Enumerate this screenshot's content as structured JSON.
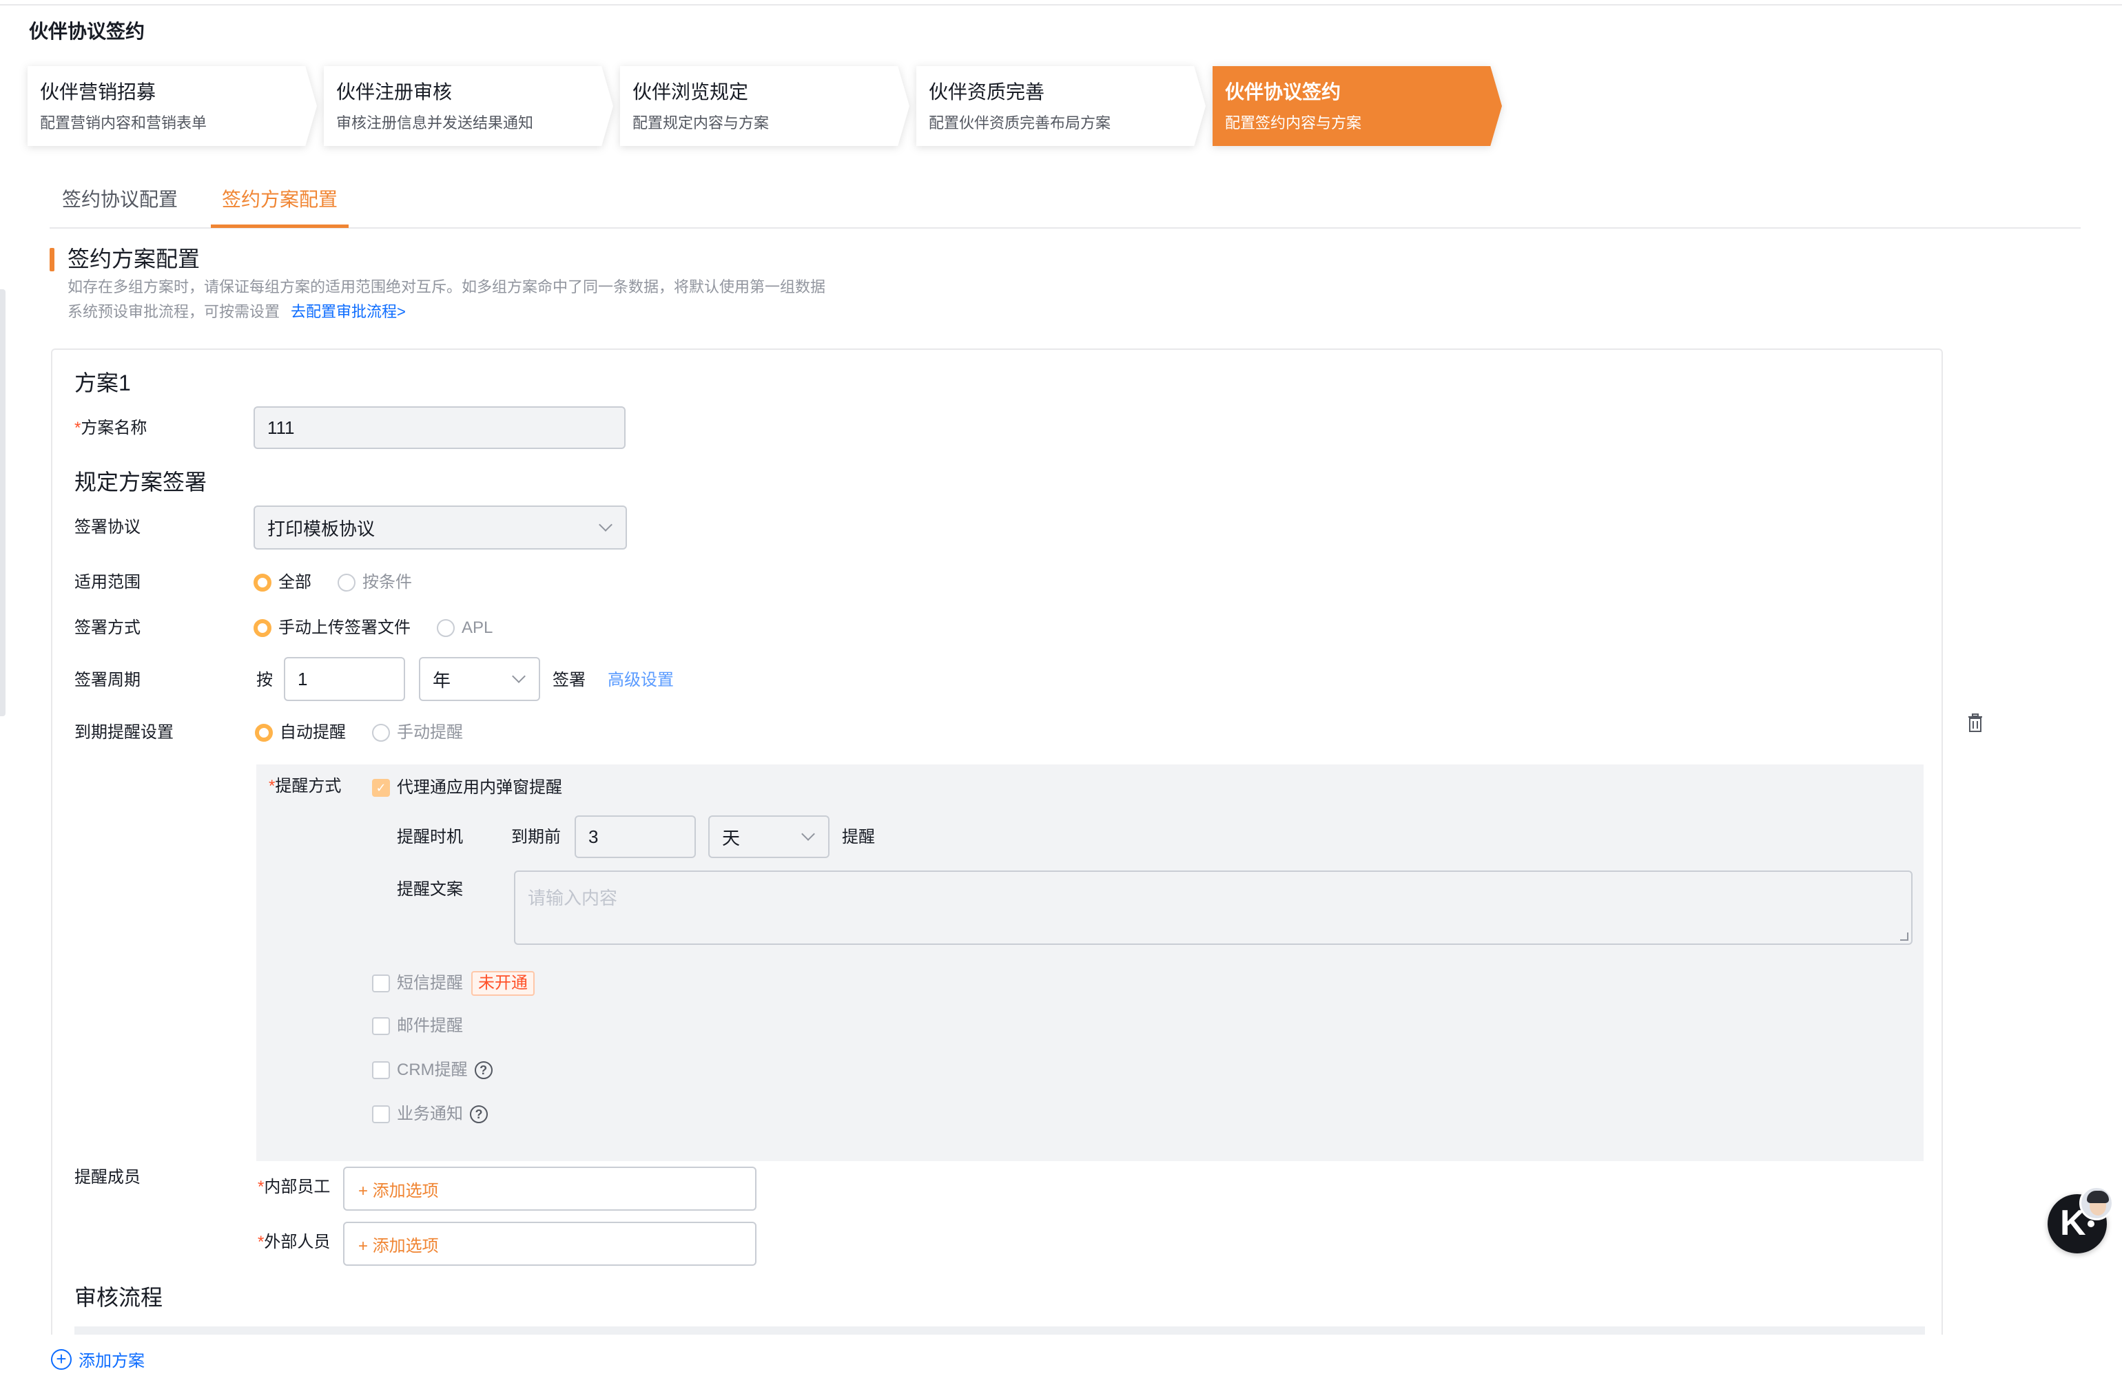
{
  "page": {
    "title": "伙伴协议签约"
  },
  "steps": [
    {
      "title": "伙伴营销招募",
      "desc": "配置营销内容和营销表单"
    },
    {
      "title": "伙伴注册审核",
      "desc": "审核注册信息并发送结果通知"
    },
    {
      "title": "伙伴浏览规定",
      "desc": "配置规定内容与方案"
    },
    {
      "title": "伙伴资质完善",
      "desc": "配置伙伴资质完善布局方案"
    },
    {
      "title": "伙伴协议签约",
      "desc": "配置签约内容与方案",
      "active": true
    }
  ],
  "tabs": [
    {
      "label": "签约协议配置"
    },
    {
      "label": "签约方案配置",
      "active": true
    }
  ],
  "section": {
    "title": "签约方案配置",
    "hint1": "如存在多组方案时，请保证每组方案的适用范围绝对互斥。如多组方案命中了同一条数据，将默认使用第一组数据",
    "hint2": "系统预设审批流程，可按需设置",
    "hint_link": "去配置审批流程>"
  },
  "plan": {
    "title": "方案1",
    "name_label": "方案名称",
    "name_value": "111",
    "rules_heading": "规定方案签署",
    "agreement_label": "签署协议",
    "agreement_value": "打印模板协议",
    "scope_label": "适用范围",
    "scope_options": [
      "全部",
      "按条件"
    ],
    "scope_selected": "全部",
    "method_label": "签署方式",
    "method_options": [
      "手动上传签署文件",
      "APL"
    ],
    "method_selected": "手动上传签署文件",
    "cycle_label": "签署周期",
    "cycle_prefix": "按",
    "cycle_value": "1",
    "cycle_unit": "年",
    "cycle_suffix": "签署",
    "cycle_advanced": "高级设置",
    "expiry_label": "到期提醒设置",
    "expiry_options": [
      "自动提醒",
      "手动提醒"
    ],
    "expiry_selected": "自动提醒",
    "remind": {
      "method_label": "提醒方式",
      "popup_label": "代理通应用内弹窗提醒",
      "popup_checked": true,
      "timing_label": "提醒时机",
      "timing_prefix": "到期前",
      "timing_value": "3",
      "timing_unit": "天",
      "timing_suffix": "提醒",
      "copy_label": "提醒文案",
      "copy_placeholder": "请输入内容",
      "sms_label": "短信提醒",
      "sms_badge": "未开通",
      "email_label": "邮件提醒",
      "crm_label": "CRM提醒",
      "biz_label": "业务通知"
    },
    "members_label": "提醒成员",
    "internal_label": "内部员工",
    "external_label": "外部人员",
    "add_option": "+ 添加选项",
    "review_heading": "审核流程"
  },
  "footer": {
    "add_plan": "添加方案"
  },
  "icons": {
    "delete": "trash-icon",
    "help": "question-circle-icon",
    "add": "plus-circle-icon",
    "dropdown": "chevron-down-icon",
    "assistant": "assistant-k-icon"
  },
  "colors": {
    "accent": "#f08533",
    "link": "#0c6cff",
    "required": "#ff522a",
    "text": "#181c25",
    "muted": "#91959e"
  }
}
